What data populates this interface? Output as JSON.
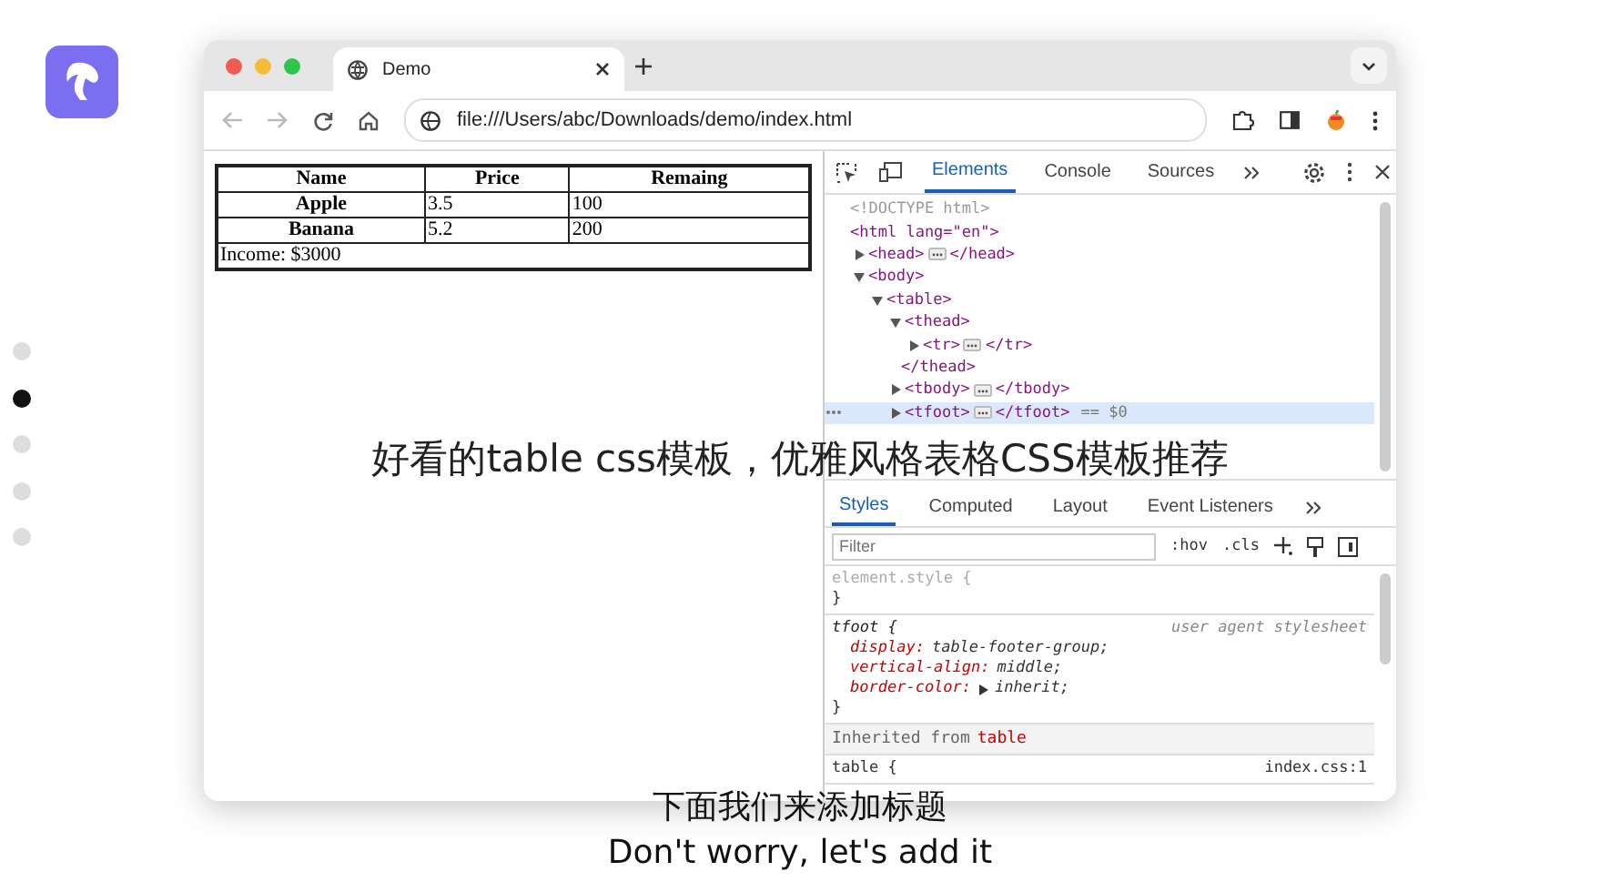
{
  "slides": [
    {
      "selected": false
    },
    {
      "selected": true
    },
    {
      "selected": false
    },
    {
      "selected": false
    },
    {
      "selected": false
    }
  ],
  "browser": {
    "tab_title": "Demo",
    "url": "file:///Users/abc/Downloads/demo/index.html"
  },
  "page_table": {
    "columns": [
      "Name",
      "Price",
      "Remaing"
    ],
    "rows": [
      [
        "Apple",
        "3.5",
        "100"
      ],
      [
        "Banana",
        "5.2",
        "200"
      ]
    ],
    "footer": "Income: $3000"
  },
  "devtools": {
    "tabs": [
      {
        "label": "Elements",
        "selected": true
      },
      {
        "label": "Console",
        "selected": false
      },
      {
        "label": "Sources",
        "selected": false
      }
    ],
    "dom_tree": [
      {
        "kind": "plain",
        "text": "<!DOCTYPE html>",
        "selected": false
      },
      {
        "kind": "open",
        "text": "<html lang=\"en\">",
        "selected": false,
        "children": [
          {
            "kind": "collapsed",
            "text": "<head>",
            "close": "</head>",
            "selected": false
          },
          {
            "kind": "expanded",
            "text": "<body>",
            "selected": false,
            "children": [
              {
                "kind": "expanded",
                "text": "<table>",
                "selected": false,
                "children": [
                  {
                    "kind": "expanded",
                    "text": "<thead>",
                    "end": "</thead>",
                    "selected": false,
                    "children": [
                      {
                        "kind": "collapsed",
                        "text": "<tr>",
                        "close": "</tr>",
                        "selected": false
                      }
                    ]
                  },
                  {
                    "kind": "collapsed",
                    "text": "<tbody>",
                    "close": "</tbody>",
                    "selected": false
                  },
                  {
                    "kind": "collapsed",
                    "text": "<tfoot>",
                    "close": "</tfoot>",
                    "selected": true,
                    "ref": "== $0"
                  }
                ]
              }
            ]
          }
        ]
      }
    ],
    "style_tabs": [
      {
        "label": "Styles",
        "selected": true
      },
      {
        "label": "Computed",
        "selected": false
      },
      {
        "label": "Layout",
        "selected": false
      },
      {
        "label": "Event Listeners",
        "selected": false
      }
    ],
    "filter": {
      "placeholder": "Filter"
    },
    "filter_buttons": [
      ":hov",
      ".cls"
    ],
    "rules": [
      {
        "selector": "element.style {",
        "muted": true,
        "close": "}"
      },
      {
        "selector": "tfoot {",
        "source": "user agent stylesheet",
        "muted": false,
        "close": "}",
        "declarations": [
          {
            "property": "display:",
            "value": "table-footer-group;",
            "expandable": false
          },
          {
            "property": "vertical-align:",
            "value": "middle;",
            "expandable": false
          },
          {
            "property": "border-color:",
            "value": "inherit;",
            "expandable": true
          }
        ]
      }
    ],
    "inherited": {
      "label": "Inherited from",
      "element": "table"
    },
    "inherited_rule": {
      "selector": "table {",
      "source": "index.css:1"
    }
  },
  "title_overlay": "好看的table css模板，优雅风格表格CSS模板推荐",
  "subtitles": [
    "下面我们来添加标题",
    "Don't worry, let's add it"
  ]
}
